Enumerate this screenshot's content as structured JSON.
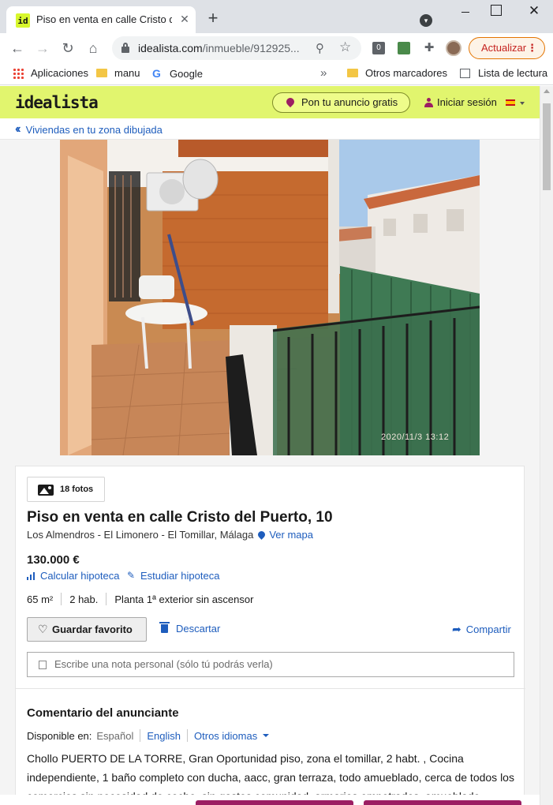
{
  "browser": {
    "tab_title": "Piso en venta en calle Cristo del P",
    "tab_favicon": "id",
    "url_host": "idealista.com",
    "url_rest": "/inmueble/912925...",
    "update_label": "Actualizar",
    "icons": [
      "back-icon",
      "forward-icon",
      "reload-icon",
      "home-icon",
      "lock-icon",
      "zoom-icon",
      "star-icon",
      "extensions-icon"
    ]
  },
  "bookmarks": {
    "apps": "Aplicaciones",
    "manu": "manu",
    "google": "Google",
    "more": "»",
    "others": "Otros marcadores",
    "reading_list": "Lista de lectura"
  },
  "site": {
    "logo": "idealista",
    "publish": "Pon tu anuncio gratis",
    "login": "Iniciar sesión",
    "back_link": "Viviendas en tu zona dibujada"
  },
  "photo": {
    "timestamp": "2020/11/3  13:12"
  },
  "listing": {
    "photos_count": "18 fotos",
    "title": "Piso en venta en calle Cristo del Puerto, 10",
    "location": "Los Almendros - El Limonero - El Tomillar, Málaga",
    "map_link": "Ver mapa",
    "price": "130.000 €",
    "calc_mortgage": "Calcular hipoteca",
    "study_mortgage": "Estudiar hipoteca",
    "features": [
      "65 m²",
      "2 hab.",
      "Planta 1ª exterior sin ascensor"
    ],
    "save_favorite": "Guardar favorito",
    "discard": "Descartar",
    "share": "Compartir",
    "note_placeholder": "Escribe una nota personal (sólo tú podrás verla)"
  },
  "comment": {
    "title": "Comentario del anunciante",
    "available_in": "Disponible en:",
    "lang_current": "Español",
    "lang_english": "English",
    "lang_other": "Otros idiomas",
    "text": "Chollo PUERTO DE LA TORRE, Gran Oportunidad piso, zona el tomillar, 2 habt. , Cocina independiente, 1 baño completo con ducha, aacc, gran terraza, todo amueblado, cerca de todos los comercios sin necesidad de coche, sin gastos comunidad, armarios empotrados, amueblado"
  },
  "colors": {
    "brand_lime": "#e1f56e",
    "link_blue": "#1e5dbd",
    "brand_magenta": "#9c1e63"
  }
}
